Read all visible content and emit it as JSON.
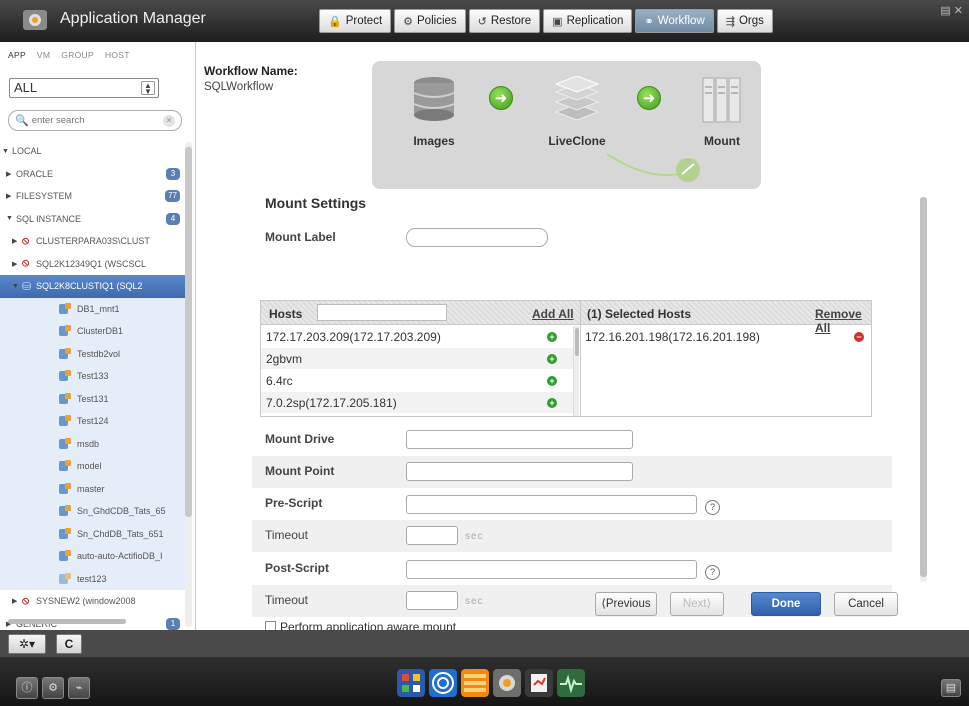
{
  "app": {
    "title": "Application Manager"
  },
  "topnav": [
    {
      "icon": "lock-icon",
      "glyph": "🔒",
      "label": "Protect"
    },
    {
      "icon": "policy-icon",
      "glyph": "⚙",
      "label": "Policies"
    },
    {
      "icon": "restore-icon",
      "glyph": "↺",
      "label": "Restore"
    },
    {
      "icon": "replication-icon",
      "glyph": "▣",
      "label": "Replication"
    },
    {
      "icon": "workflow-icon",
      "glyph": "⚭",
      "label": "Workflow",
      "active": true
    },
    {
      "icon": "orgs-icon",
      "glyph": "⇶",
      "label": "Orgs"
    }
  ],
  "sidebar": {
    "tabs": [
      "APP",
      "VM",
      "GROUP",
      "HOST"
    ],
    "filter": "ALL",
    "search_placeholder": "enter search",
    "tree": [
      {
        "label": "LOCAL",
        "indent": 0,
        "expanded": true
      },
      {
        "label": "ORACLE",
        "indent": 1,
        "collapsed": true,
        "badge": "3"
      },
      {
        "label": "FILESYSTEM",
        "indent": 1,
        "collapsed": true,
        "badge": "77"
      },
      {
        "label": "SQL INSTANCE",
        "indent": 1,
        "expanded": true,
        "badge": "4"
      },
      {
        "label": "CLUSTERPARA03S\\CLUST",
        "indent": 2,
        "collapsed": true,
        "type": "no"
      },
      {
        "label": "SQL2K12349Q1 (WSCSCL",
        "indent": 2,
        "collapsed": true,
        "type": "no"
      },
      {
        "label": "SQL2K8CLUSTIQ1 (SQL2",
        "indent": 2,
        "expanded": true,
        "type": "sel"
      },
      {
        "label": "DB1_mnt1",
        "indent": 3,
        "type": "db"
      },
      {
        "label": "ClusterDB1",
        "indent": 3,
        "type": "db"
      },
      {
        "label": "Testdb2vol",
        "indent": 3,
        "type": "db"
      },
      {
        "label": "Test133",
        "indent": 3,
        "type": "db"
      },
      {
        "label": "Test131",
        "indent": 3,
        "type": "db"
      },
      {
        "label": "Test124",
        "indent": 3,
        "type": "db"
      },
      {
        "label": "msdb",
        "indent": 3,
        "type": "db"
      },
      {
        "label": "model",
        "indent": 3,
        "type": "db"
      },
      {
        "label": "master",
        "indent": 3,
        "type": "db"
      },
      {
        "label": "Sn_GhdCDB_Tats_65",
        "indent": 3,
        "type": "db"
      },
      {
        "label": "Sn_ChdDB_Tats_651",
        "indent": 3,
        "type": "db"
      },
      {
        "label": "auto-auto-ActifioDB_I",
        "indent": 3,
        "type": "db"
      },
      {
        "label": "test123",
        "indent": 3,
        "type": "file"
      },
      {
        "label": "SYSNEW2 (window2008",
        "indent": 2,
        "collapsed": true,
        "type": "no"
      },
      {
        "label": "GENERIC",
        "indent": 1,
        "collapsed": true,
        "badge": "1"
      }
    ]
  },
  "workflow": {
    "name_label": "Workflow Name:",
    "name_value": "SQLWorkflow",
    "steps": [
      "Images",
      "LiveClone",
      "Mount"
    ]
  },
  "mount": {
    "title": "Mount Settings",
    "label_field": "Mount Label",
    "hosts_header": "Hosts",
    "add_all": "Add All",
    "selected_header": "(1) Selected Hosts",
    "remove_all": "Remove All",
    "hosts": [
      "172.17.203.209(172.17.203.209)",
      "2gbvm",
      "6.4rc",
      "7.0.2sp(172.17.205.181)"
    ],
    "selected_hosts": [
      "172.16.201.198(172.16.201.198)"
    ],
    "mount_drive": "Mount Drive",
    "mount_point": "Mount Point",
    "pre_script": "Pre-Script",
    "timeout": "Timeout",
    "sec": "sec",
    "post_script": "Post-Script",
    "aware": "Perform application aware mount"
  },
  "buttons": {
    "previous": "⟨Previous",
    "next": "Next⟩",
    "done": "Done",
    "cancel": "Cancel"
  },
  "toolbar": {
    "settings": "✲▾",
    "refresh": "C"
  }
}
